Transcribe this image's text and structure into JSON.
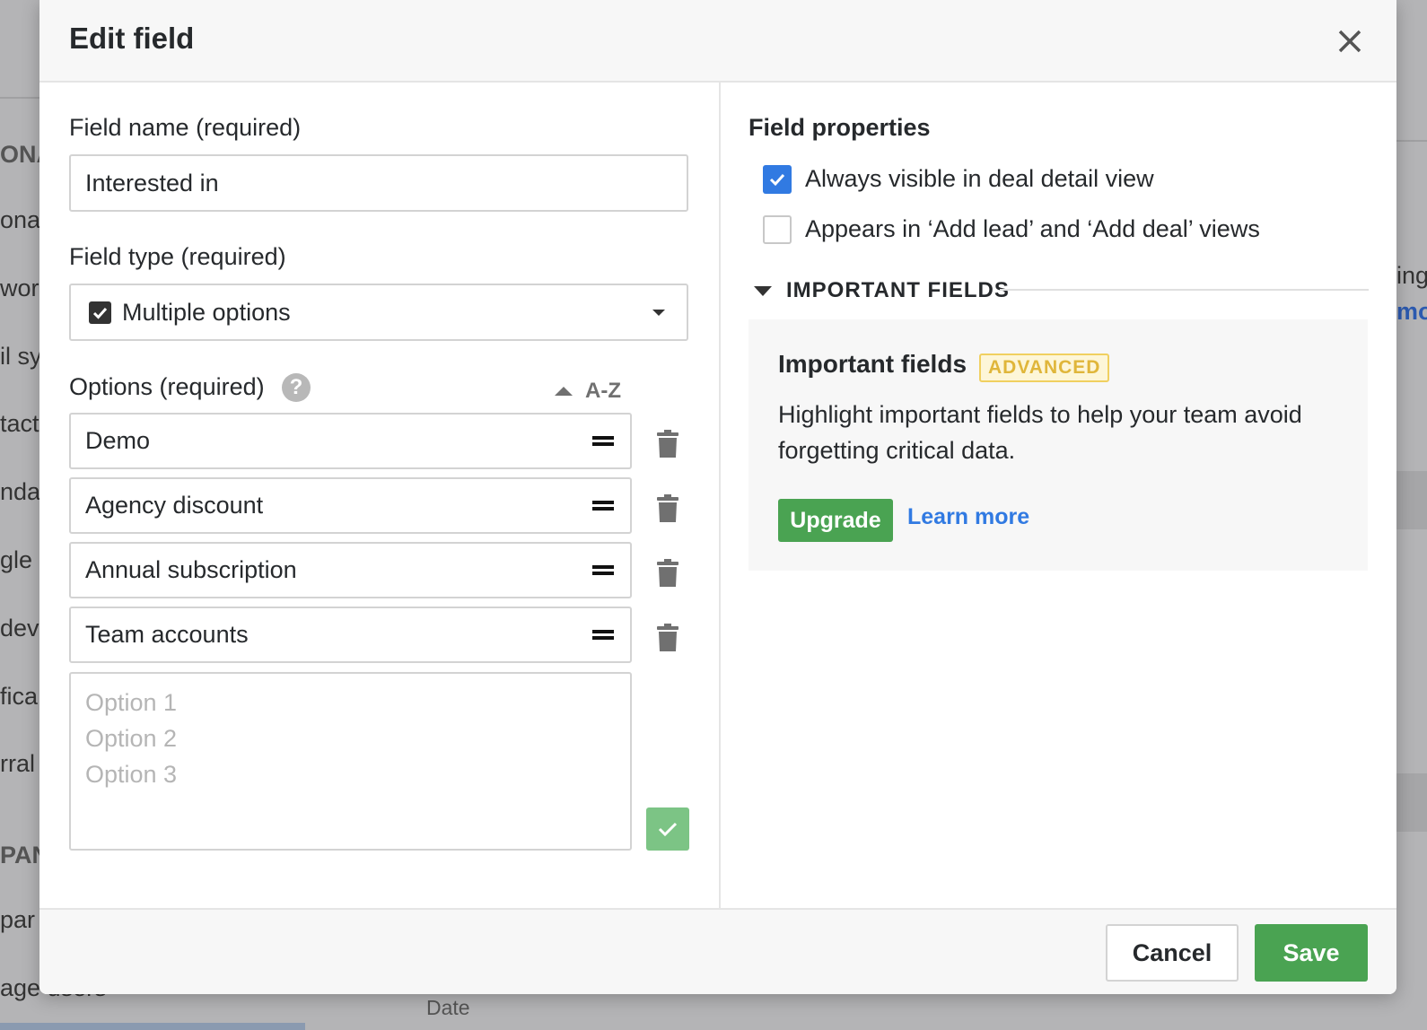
{
  "background": {
    "fragments": [
      "ONA",
      "ona",
      "wor",
      "il sy",
      "tact",
      "nda",
      "gle I",
      "dev",
      "fica",
      "rral",
      "PANY",
      "par",
      "age users",
      "ing",
      "mo",
      "Date"
    ]
  },
  "dialog": {
    "title": "Edit field",
    "close_icon": "close-icon"
  },
  "left": {
    "field_name_label": "Field name (required)",
    "field_name_value": "Interested in",
    "field_type_label": "Field type (required)",
    "field_type_value": "Multiple options",
    "options_label": "Options (required)",
    "sort_label": "A-Z",
    "options": [
      "Demo",
      "Agency discount",
      "Annual subscription",
      "Team accounts"
    ],
    "new_option_placeholder": "Option 1\nOption 2\nOption 3"
  },
  "right": {
    "properties_title": "Field properties",
    "prop_always_visible": "Always visible in deal detail view",
    "prop_always_visible_checked": true,
    "prop_appears_add": "Appears in ‘Add lead’ and ‘Add deal’ views",
    "prop_appears_add_checked": false,
    "section_title": "IMPORTANT FIELDS",
    "card_title": "Important fields",
    "badge": "ADVANCED",
    "card_text": "Highlight important fields to help your team avoid forgetting critical data.",
    "upgrade": "Upgrade",
    "learn_more": "Learn more"
  },
  "footer": {
    "cancel": "Cancel",
    "save": "Save"
  },
  "colors": {
    "primary_green": "#4aa352",
    "check_blue": "#317ae2",
    "link_blue": "#317ae2",
    "badge_yellow": "#e0b63a"
  }
}
